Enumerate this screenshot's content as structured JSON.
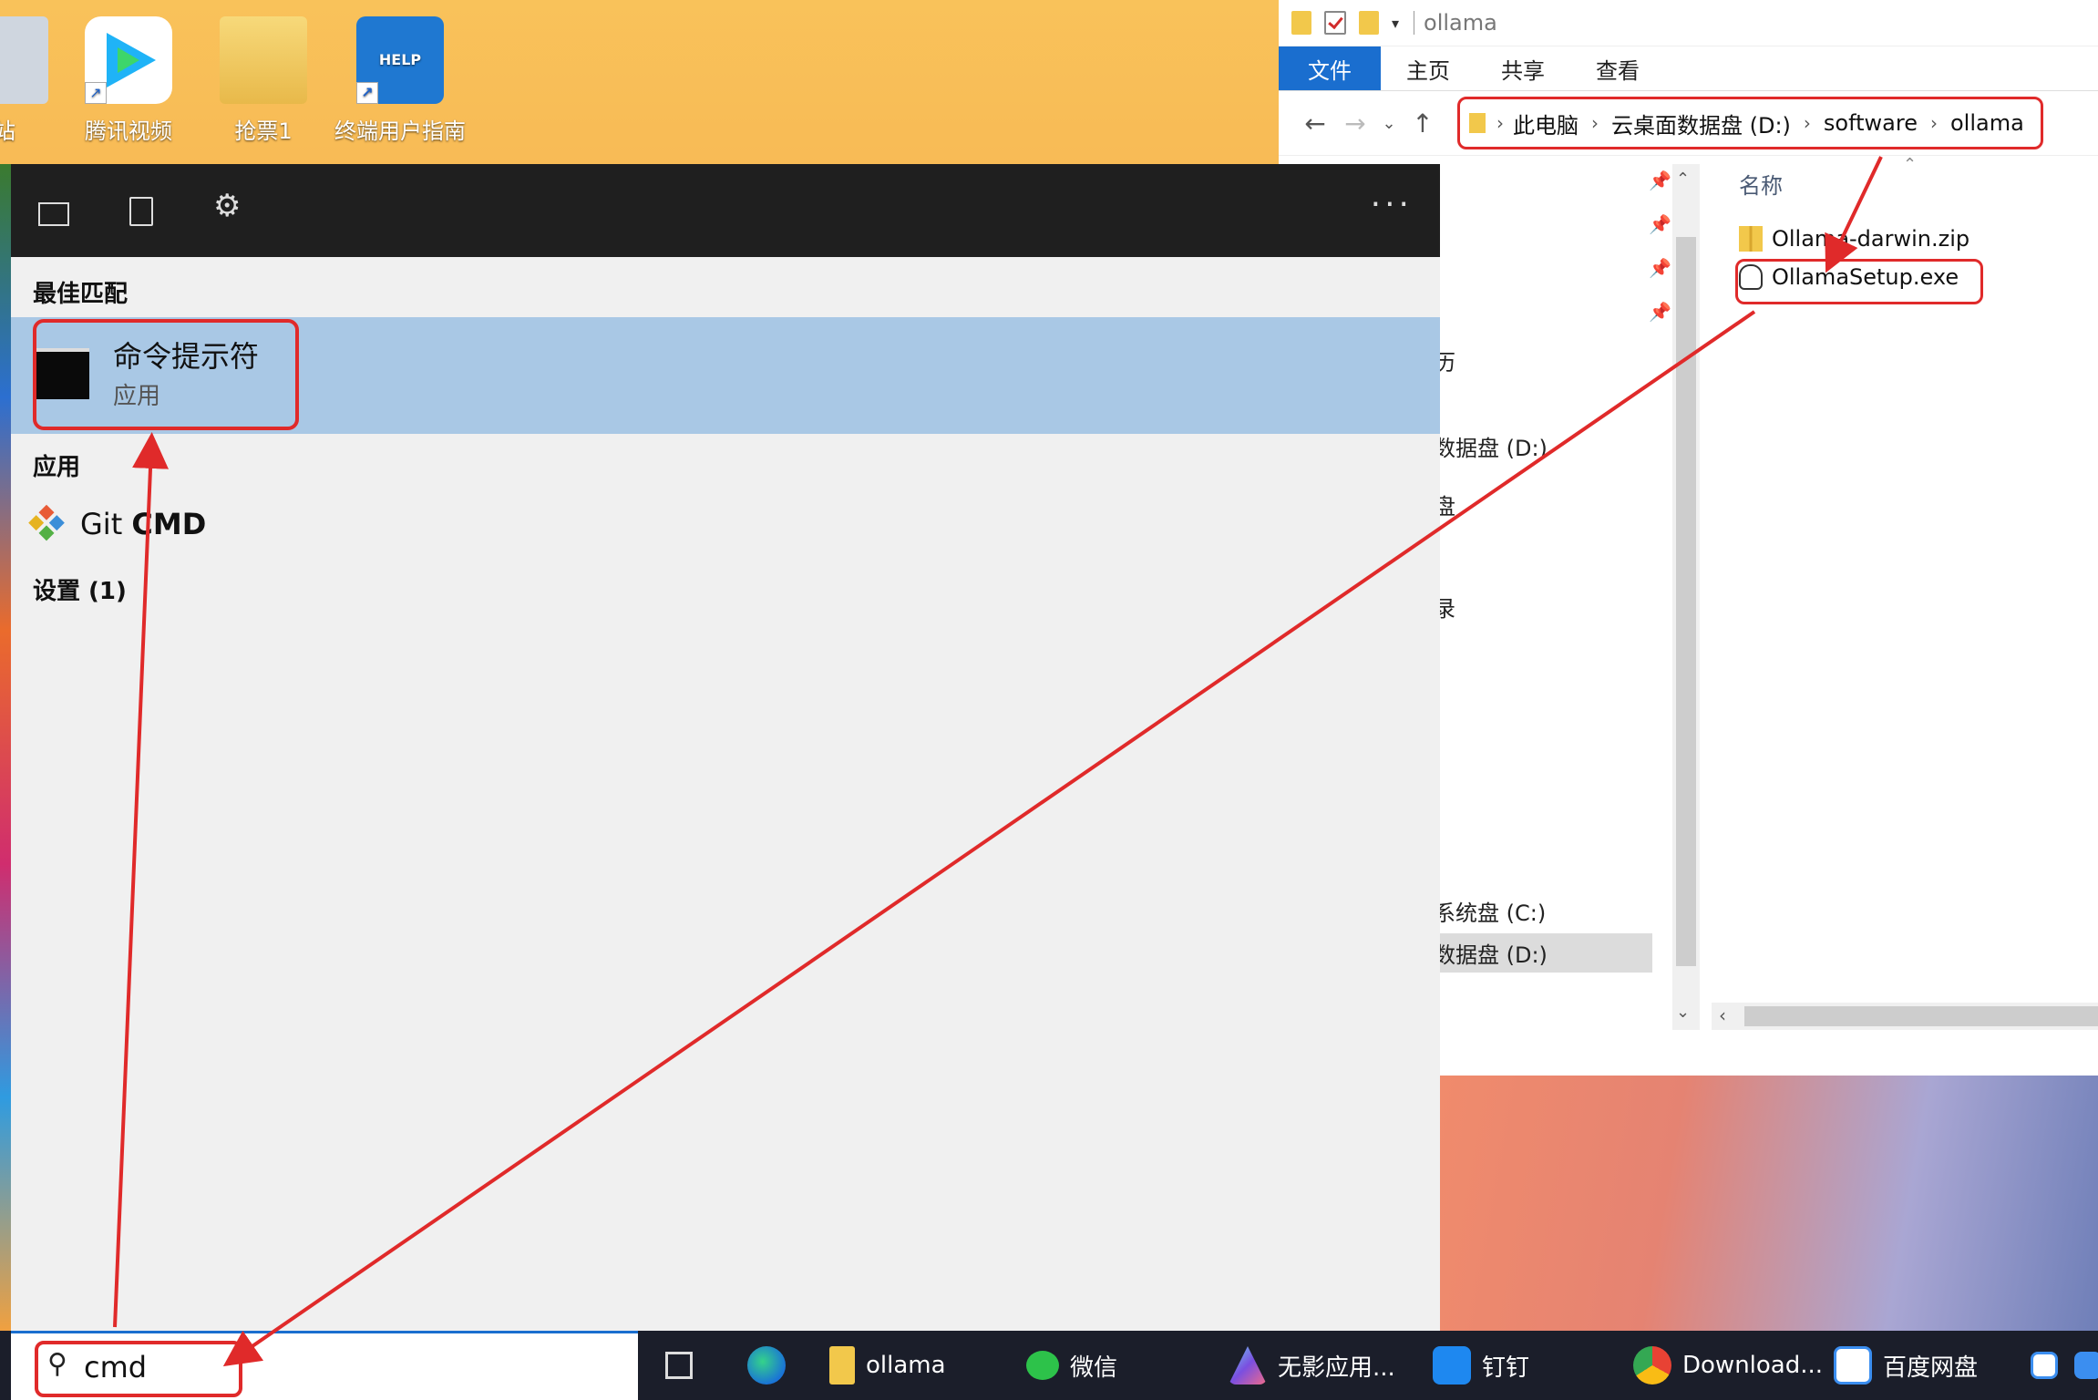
{
  "desktop": {
    "icons": [
      {
        "label": "站",
        "icon": "recycle-bin-icon"
      },
      {
        "label": "腾讯视频",
        "icon": "tencent-video-icon"
      },
      {
        "label": "抢票1",
        "icon": "folder-icon"
      },
      {
        "label": "终端用户指南",
        "icon": "help-book-icon"
      }
    ],
    "help_badge": "HELP"
  },
  "explorer": {
    "window_title": "ollama",
    "ribbon_tabs": [
      "文件",
      "主页",
      "共享",
      "查看"
    ],
    "breadcrumb": [
      "此电脑",
      "云桌面数据盘 (D:)",
      "software",
      "ollama"
    ],
    "column_header": "名称",
    "files": [
      {
        "name": "Ollama-darwin.zip",
        "icon": "zip-folder-icon"
      },
      {
        "name": "OllamaSetup.exe",
        "icon": "ollama-exe-icon"
      }
    ],
    "nav_items": [
      "历",
      "数据盘 (D:)",
      "盘",
      "录",
      "系统盘 (C:)",
      "数据盘 (D:)"
    ]
  },
  "start_search": {
    "section_best": "最佳匹配",
    "best_match": {
      "title": "命令提示符",
      "subtitle": "应用"
    },
    "section_apps": "应用",
    "app_item_prefix": "Git ",
    "app_item_bold": "CMD",
    "section_settings": "设置 (1)",
    "more_label": "···"
  },
  "taskbar": {
    "search_text": "cmd",
    "items": [
      {
        "label": "",
        "icon": "task-view-icon"
      },
      {
        "label": "",
        "icon": "edge-icon"
      },
      {
        "label": "ollama",
        "icon": "folder-icon"
      },
      {
        "label": "微信",
        "icon": "wechat-icon"
      },
      {
        "label": "无影应用...",
        "icon": "wuying-icon"
      },
      {
        "label": "钉钉",
        "icon": "dingtalk-icon"
      },
      {
        "label": "Download...",
        "icon": "chrome-icon"
      },
      {
        "label": "百度网盘",
        "icon": "baidu-netdisk-icon"
      }
    ]
  },
  "annotation_color": "#e02a2a",
  "accent_color": "#1a6ecf"
}
